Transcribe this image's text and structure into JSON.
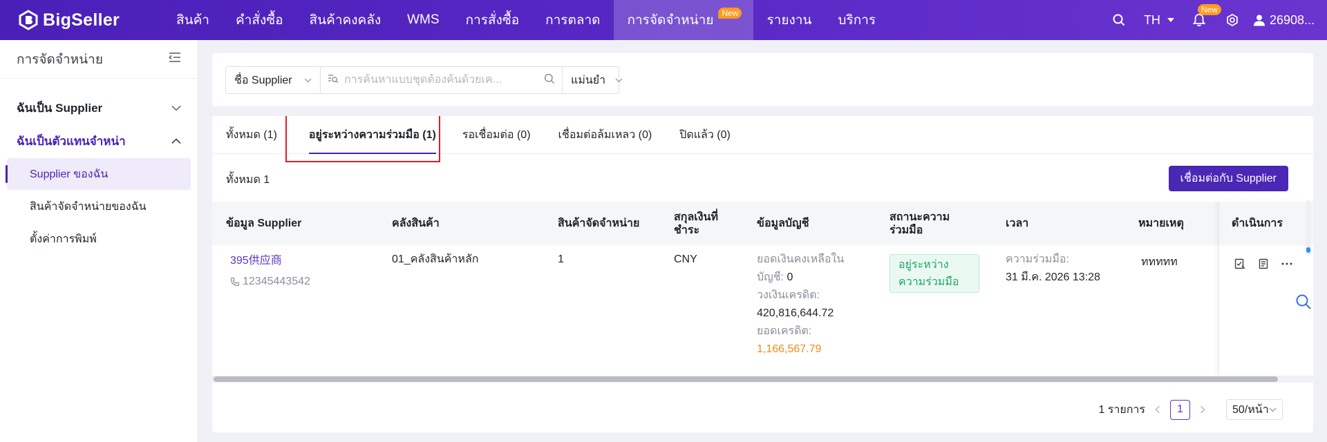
{
  "brand": {
    "name": "BigSeller"
  },
  "nav": {
    "items": [
      {
        "label": "สินค้า"
      },
      {
        "label": "คำสั่งซื้อ"
      },
      {
        "label": "สินค้าคงคลัง"
      },
      {
        "label": "WMS"
      },
      {
        "label": "การสั่งซื้อ"
      },
      {
        "label": "การตลาด"
      },
      {
        "label": "การจัดจำหน่าย",
        "badge": "New",
        "active": true
      },
      {
        "label": "รายงาน"
      },
      {
        "label": "บริการ"
      }
    ],
    "lang": "TH",
    "bell_badge": "New",
    "user": "26908..."
  },
  "sidebar": {
    "title": "การจัดจำหน่าย",
    "groups": [
      {
        "label": "ฉันเป็น Supplier",
        "open": false
      },
      {
        "label": "ฉันเป็นตัวแทนจำหน่า",
        "open": true,
        "items": [
          {
            "label": "Supplier ของฉัน",
            "active": true
          },
          {
            "label": "สินค้าจัดจำหน่ายของฉัน"
          },
          {
            "label": "ตั้งค่าการพิมพ์"
          }
        ]
      }
    ]
  },
  "filters": {
    "field_select": "ชื่อ Supplier",
    "search_placeholder": "การค้นหาแบบชุดต้องค้นด้วยเค...",
    "match_select": "แม่นยำ"
  },
  "tabs": [
    {
      "label": "ทั้งหมด (1)"
    },
    {
      "label": "อยู่ระหว่างความร่วมมือ (1)",
      "active": true
    },
    {
      "label": "รอเชื่อมต่อ (0)"
    },
    {
      "label": "เชื่อมต่อล้มเหลว (0)"
    },
    {
      "label": "ปิดแล้ว (0)"
    }
  ],
  "total_label": "ทั้งหมด 1",
  "connect_button": "เชื่อมต่อกับ Supplier",
  "table": {
    "columns": {
      "supplier": "ข้อมูล Supplier",
      "warehouse": "คลังสินค้า",
      "products": "สินค้าจัดจำหน่าย",
      "currency": "สกุลเงินที่ชำระ",
      "account": "ข้อมูลบัญชี",
      "status": "สถานะความร่วมมือ",
      "time": "เวลา",
      "note": "หมายเหตุ",
      "actions": "ดำเนินการ"
    },
    "rows": [
      {
        "supplier_name": "395供应商",
        "phone": "12345443542",
        "warehouse": "01_คลังสินค้าหลัก",
        "products": "1",
        "currency": "CNY",
        "balance_label": "ยอดเงินคงเหลือในบัญชี:",
        "balance_value": "0",
        "credit_limit_label": "วงเงินเครดิต:",
        "credit_limit_value": "420,816,644.72",
        "credit_balance_label": "ยอดเครดิต:",
        "credit_balance_value": "1,166,567.79",
        "status": "อยู่ระหว่างความร่วมมือ",
        "time_label": "ความร่วมมือ:",
        "time_value": "31 มี.ค. 2026 13:28",
        "note": "ททททท"
      }
    ]
  },
  "pagination": {
    "total": "1 รายการ",
    "current": "1",
    "page_size": "50/หน้า"
  },
  "colors": {
    "brand": "#4a1fb8",
    "accent_badge": "#ff9a1f",
    "status_green": "#1fa761",
    "credit_orange": "#f08c1a",
    "highlight_red": "#e11b22"
  }
}
